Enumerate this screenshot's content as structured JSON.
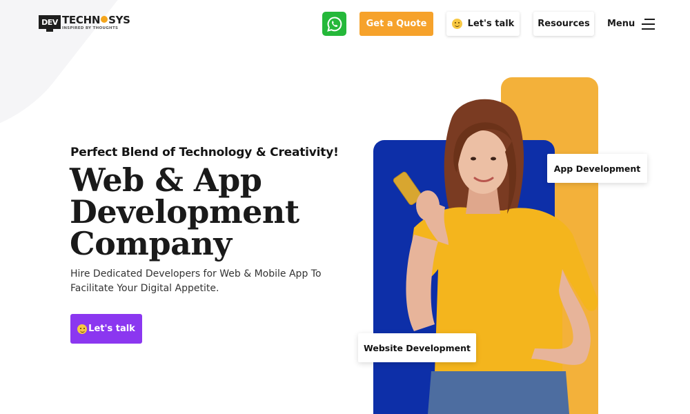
{
  "header": {
    "logo": {
      "mark": "DEV",
      "word_a": "TECHN",
      "word_b": "SYS",
      "tagline": "INSPIRED BY THOUGHTS"
    },
    "whatsapp_icon": "whatsapp-icon",
    "quote_label": "Get a Quote",
    "talk_label": "Let's talk",
    "resources_label": "Resources",
    "menu_label": "Menu"
  },
  "hero": {
    "tagline": "Perfect Blend of Technology & Creativity!",
    "headline": [
      "Web & App",
      "Development",
      "Company"
    ],
    "subtitle": "Hire Dedicated Developers for Web & Mobile App To Facilitate Your Digital Appetite.",
    "cta_label": "Let's talk",
    "tags": {
      "app": "App Development",
      "web": "Website Development"
    }
  },
  "colors": {
    "quote_button": "#f6a22b",
    "cta_button": "#8b37f0",
    "panel_blue": "#0d2fa8",
    "panel_orange": "#f3b13a",
    "whatsapp": "#25b83a"
  }
}
